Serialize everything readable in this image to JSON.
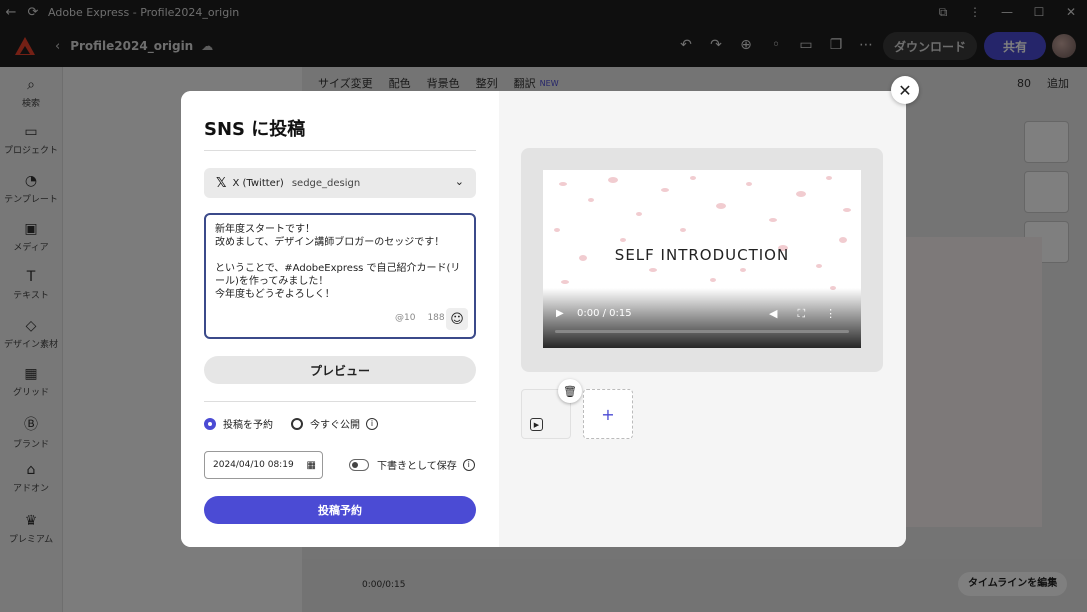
{
  "window": {
    "title": "Adobe Express - Profile2024_origin"
  },
  "header": {
    "doc_title": "Profile2024_origin",
    "download_label": "ダウンロード",
    "share_label": "共有"
  },
  "rail": {
    "items": [
      {
        "label": "検索",
        "icon": "search-icon"
      },
      {
        "label": "プロジェクト",
        "icon": "folder-icon"
      },
      {
        "label": "テンプレート",
        "icon": "template-icon"
      },
      {
        "label": "メディア",
        "icon": "media-icon"
      },
      {
        "label": "テキスト",
        "icon": "text-icon"
      },
      {
        "label": "デザイン素材",
        "icon": "shapes-icon"
      },
      {
        "label": "グリッド",
        "icon": "grid-icon"
      },
      {
        "label": "ブランド",
        "icon": "brand-icon"
      },
      {
        "label": "アドオン",
        "icon": "addon-icon"
      },
      {
        "label": "プレミアム",
        "icon": "crown-icon"
      }
    ]
  },
  "canvas_toolbar": {
    "items": [
      "サイズ変更",
      "配色",
      "背景色",
      "整列",
      "翻訳"
    ],
    "new_badge": "NEW",
    "zoom": "80",
    "add_label": "追加"
  },
  "timeline": {
    "time": "0:00/0:15",
    "edit_label": "タイムラインを編集"
  },
  "modal": {
    "title": "SNS に投稿",
    "account": {
      "network": "X (Twitter)",
      "handle": "sedge_design"
    },
    "post_text": "新年度スタートです！\n改めまして、デザイン講師ブロガーのセッジです！\n\nということで、#AdobeExpress で自己紹介カード(リール)を作ってみました！\n今年度もどうぞよろしく！",
    "mention_count": "@10",
    "char_count": "188",
    "preview_label": "プレビュー",
    "schedule_label": "投稿を予約",
    "publish_now_label": "今すぐ公開",
    "datetime_value": "2024/04/10 08:19",
    "draft_label": "下書きとして保存",
    "submit_label": "投稿予約",
    "video": {
      "title": "SELF INTRODUCTION",
      "time": "0:00 / 0:15"
    }
  },
  "colors": {
    "accent": "#4b4bd4",
    "dark": "#1e1e1e"
  }
}
